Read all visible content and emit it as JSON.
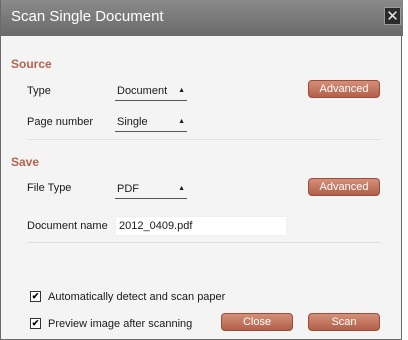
{
  "dialog": {
    "title": "Scan Single Document",
    "close_glyph": "✕"
  },
  "source": {
    "heading": "Source",
    "type_label": "Type",
    "type_value": "Document",
    "page_label": "Page number",
    "page_value": "Single",
    "advanced_label": "Advanced"
  },
  "save": {
    "heading": "Save",
    "filetype_label": "File Type",
    "filetype_value": "PDF",
    "docname_label": "Document name",
    "docname_value": "2012_0409.pdf",
    "advanced_label": "Advanced"
  },
  "options": {
    "auto_detect_label": "Automatically detect and scan  paper",
    "auto_detect_checked": true,
    "preview_label": "Preview image after scanning",
    "preview_checked": true,
    "check_glyph": "✔"
  },
  "footer": {
    "close_label": "Close",
    "scan_label": "Scan"
  },
  "colors": {
    "accent": "#b35f4a",
    "heading": "#b36450",
    "titlebar": "#6a6a6a"
  }
}
